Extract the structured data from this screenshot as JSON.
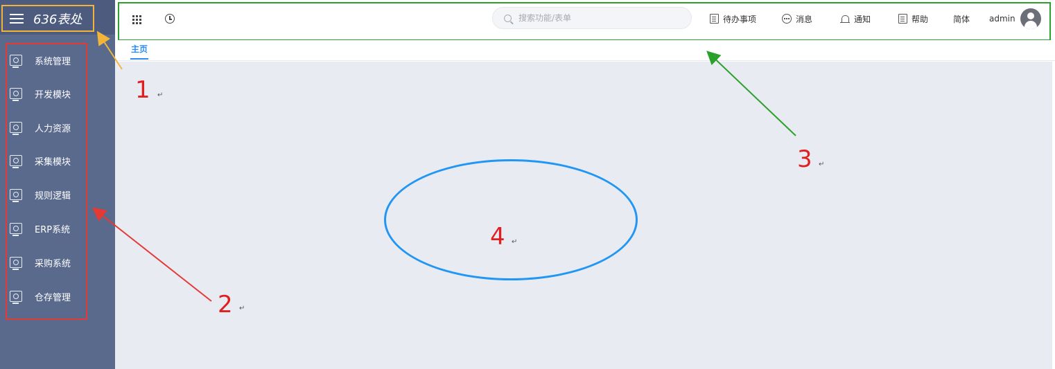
{
  "app": {
    "logo_text": "636表处"
  },
  "sidebar": {
    "items": [
      {
        "label": "系统管理",
        "icon": "monitor-gear-icon"
      },
      {
        "label": "开发模块",
        "icon": "monitor-gear-icon"
      },
      {
        "label": "人力资源",
        "icon": "monitor-gear-icon"
      },
      {
        "label": "采集模块",
        "icon": "monitor-gear-icon"
      },
      {
        "label": "规则逻辑",
        "icon": "monitor-gear-icon"
      },
      {
        "label": "ERP系统",
        "icon": "monitor-gear-icon"
      },
      {
        "label": "采购系统",
        "icon": "monitor-gear-icon"
      },
      {
        "label": "仓存管理",
        "icon": "monitor-gear-icon"
      }
    ]
  },
  "header": {
    "search_placeholder": "搜索功能/表单",
    "todo_label": "待办事项",
    "message_label": "消息",
    "notice_label": "通知",
    "help_label": "帮助",
    "lang_label": "简体",
    "user_label": "admin"
  },
  "tabs": [
    {
      "label": "主页",
      "active": true
    }
  ],
  "annotations": {
    "n1": "1",
    "n2": "2",
    "n3": "3",
    "n4": "4",
    "mark": "↵"
  },
  "colors": {
    "sidebar_bg": "#5a6a8d",
    "logo_bg": "#4c5b7e",
    "accent": "#2d8cf0",
    "main_bg": "#e9ebf2",
    "annotation_red": "#e02020",
    "annotation_green": "#2ca02c",
    "annotation_orange": "#f2b53a",
    "annotation_blue": "#2196f3"
  }
}
